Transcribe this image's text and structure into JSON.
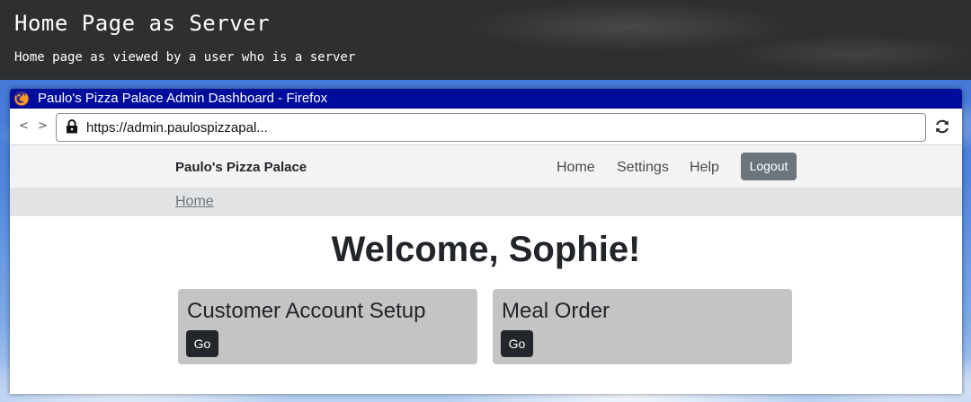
{
  "hero": {
    "title": "Home Page as Server",
    "subtitle": "Home page as viewed by a user who is a server"
  },
  "window": {
    "title": "Paulo's Pizza Palace Admin Dashboard - Firefox",
    "nav_arrows": "< >",
    "url": "https://admin.paulospizzapal..."
  },
  "navbar": {
    "brand": "Paulo's Pizza Palace",
    "links": [
      "Home",
      "Settings",
      "Help"
    ],
    "logout_label": "Logout"
  },
  "breadcrumb": {
    "items": [
      "Home"
    ]
  },
  "main": {
    "welcome": "Welcome, Sophie!",
    "cards": [
      {
        "title": "Customer Account Setup",
        "button_label": "Go"
      },
      {
        "title": "Meal Order",
        "button_label": "Go"
      }
    ]
  },
  "colors": {
    "titlebar": "#000c9a",
    "navbar_bg": "#f3f3f3",
    "breadcrumb_bg": "#e2e3e5",
    "card_bg": "#c4c4c4",
    "logout_button": "#6c757d",
    "go_button": "#23272b"
  },
  "icons": [
    "firefox-icon",
    "lock-icon",
    "reload-icon"
  ]
}
